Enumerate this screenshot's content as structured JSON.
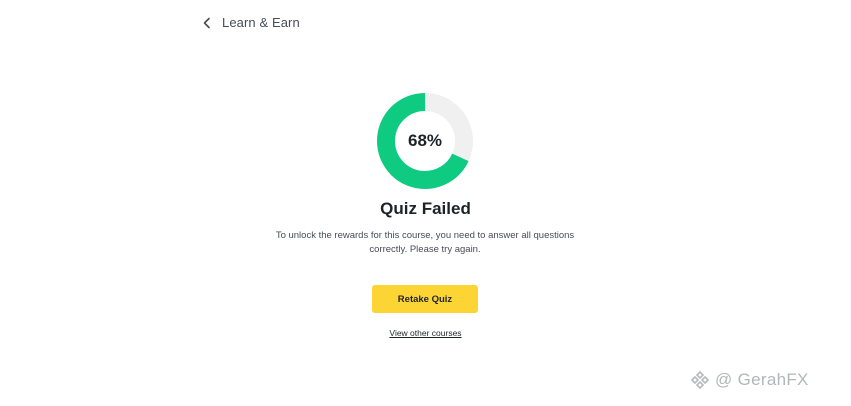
{
  "nav": {
    "back_label": "Learn & Earn",
    "back_icon": "chevron-left-icon"
  },
  "result": {
    "score_label": "68%",
    "score_fraction": 0.68,
    "progress_color": "#0ecb81",
    "track_color": "#f0f0f0",
    "title": "Quiz Failed",
    "description": "To unlock the rewards for this course, you need to answer all questions correctly. Please try again."
  },
  "actions": {
    "retake_label": "Retake Quiz",
    "retake_color": "#fcd535",
    "other_courses_label": "View other courses"
  },
  "watermark": {
    "text": "@ GerahFX",
    "logo_icon": "binance-diamond-icon"
  }
}
